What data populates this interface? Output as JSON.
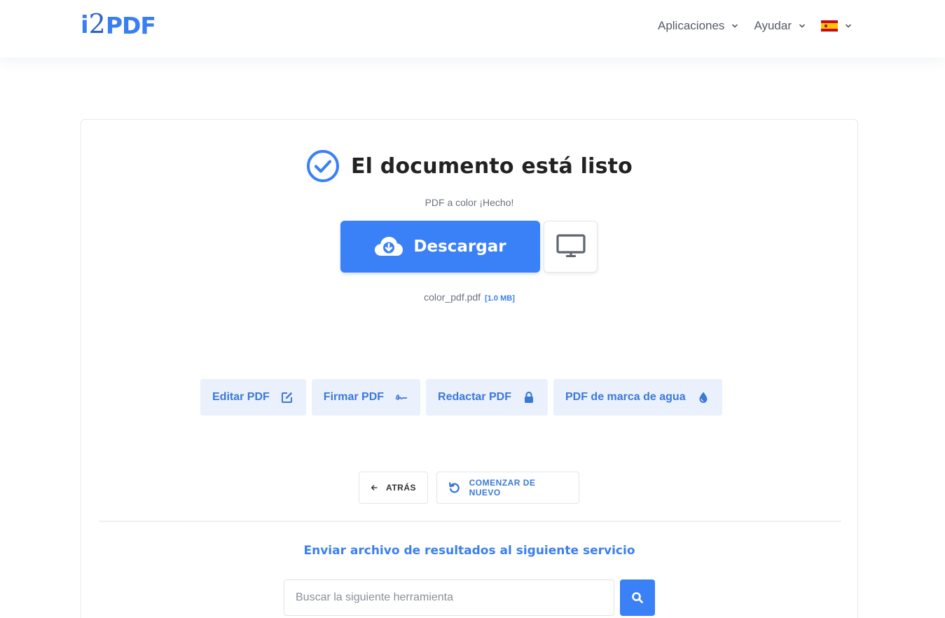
{
  "header": {
    "logo": {
      "i": "i",
      "two": "2",
      "pdf": "PDF"
    },
    "nav": [
      {
        "label": "Aplicaciones"
      },
      {
        "label": "Ayudar"
      }
    ],
    "language_flag": "es-flag-icon"
  },
  "result": {
    "title": "El documento está listo",
    "subtitle": "PDF a color ¡Hecho!",
    "download_label": "Descargar",
    "file_name": "color_pdf.pdf",
    "file_size": "[1.0 MB]"
  },
  "tools": [
    {
      "label": "Editar PDF",
      "icon": "edit-icon"
    },
    {
      "label": "Firmar PDF",
      "icon": "signature-icon"
    },
    {
      "label": "Redactar PDF",
      "icon": "lock-icon"
    },
    {
      "label": "PDF de marca de agua",
      "icon": "droplet-icon"
    }
  ],
  "actions": {
    "back_label": "ATRÁS",
    "restart_label": "COMENZAR DE NUEVO"
  },
  "send": {
    "title": "Enviar archivo de resultados al siguiente servicio",
    "search_placeholder": "Buscar la siguiente herramienta"
  },
  "colors": {
    "accent": "#3a80f6",
    "tool_bg": "#eaf1fc",
    "tool_text": "#3b79d8"
  }
}
